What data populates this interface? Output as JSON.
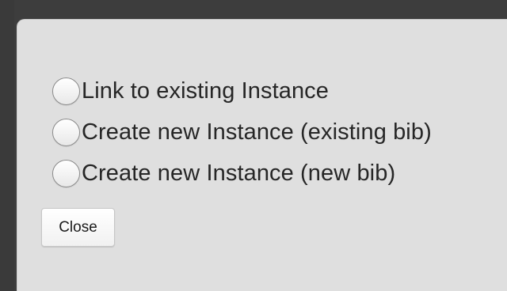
{
  "dialog": {
    "options": [
      {
        "label": "Link to existing Instance",
        "selected": false
      },
      {
        "label": "Create new Instance (existing bib)",
        "selected": false
      },
      {
        "label": "Create new Instance (new bib)",
        "selected": false
      }
    ],
    "close_label": "Close"
  },
  "colors": {
    "backdrop": "#3d3d3d",
    "dialog_background": "#dfdfdf",
    "text": "#262626"
  }
}
